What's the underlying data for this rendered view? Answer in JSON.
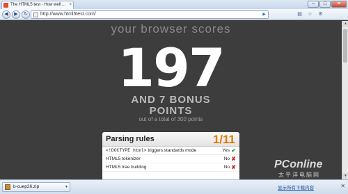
{
  "browser": {
    "tab_title": "The HTML5 test - How well ...",
    "tab_close": "×",
    "url": "http://www.html5test.com/",
    "nav": {
      "back": "◀",
      "forward": "▶",
      "reload": "↻"
    },
    "go_icon": "▶",
    "window_buttons": {
      "minimize": "–",
      "maximize": "□",
      "close": "✕"
    },
    "tool_icons": [
      "page-icon",
      "star-icon",
      "wrench-icon"
    ]
  },
  "page": {
    "scores_label": "your browser scores",
    "score": "197",
    "bonus_line1": "AND 7 BONUS",
    "bonus_line2": "POINTS",
    "out_of": "out of a total of 300 points"
  },
  "card": {
    "title": "Parsing rules",
    "score": "1/11",
    "rows": [
      {
        "code": "<!DOCTYPE html>",
        "text": " triggers standards mode",
        "result": "Yes",
        "mark": "✔"
      },
      {
        "code": "",
        "text": "HTML5 tokenizer",
        "result": "No",
        "mark": "✘"
      },
      {
        "code": "",
        "text": "HTML5 tree building",
        "result": "No",
        "mark": "✘"
      }
    ]
  },
  "scrollbar": {
    "up": "▲",
    "down": "▼"
  },
  "downloads": {
    "file_name": "b-cuep26.zip",
    "arrow": "▾",
    "show_all": "显示所有下载内容",
    "close": "✕"
  },
  "watermark": {
    "logo": "PConline",
    "sub": "太平洋电脑网"
  },
  "colors": {
    "page_bg": "#3d3d3d",
    "score_color": "#ffffff",
    "card_score": "#e07b00",
    "yes": "#3a9a2a",
    "no": "#cc2222"
  }
}
